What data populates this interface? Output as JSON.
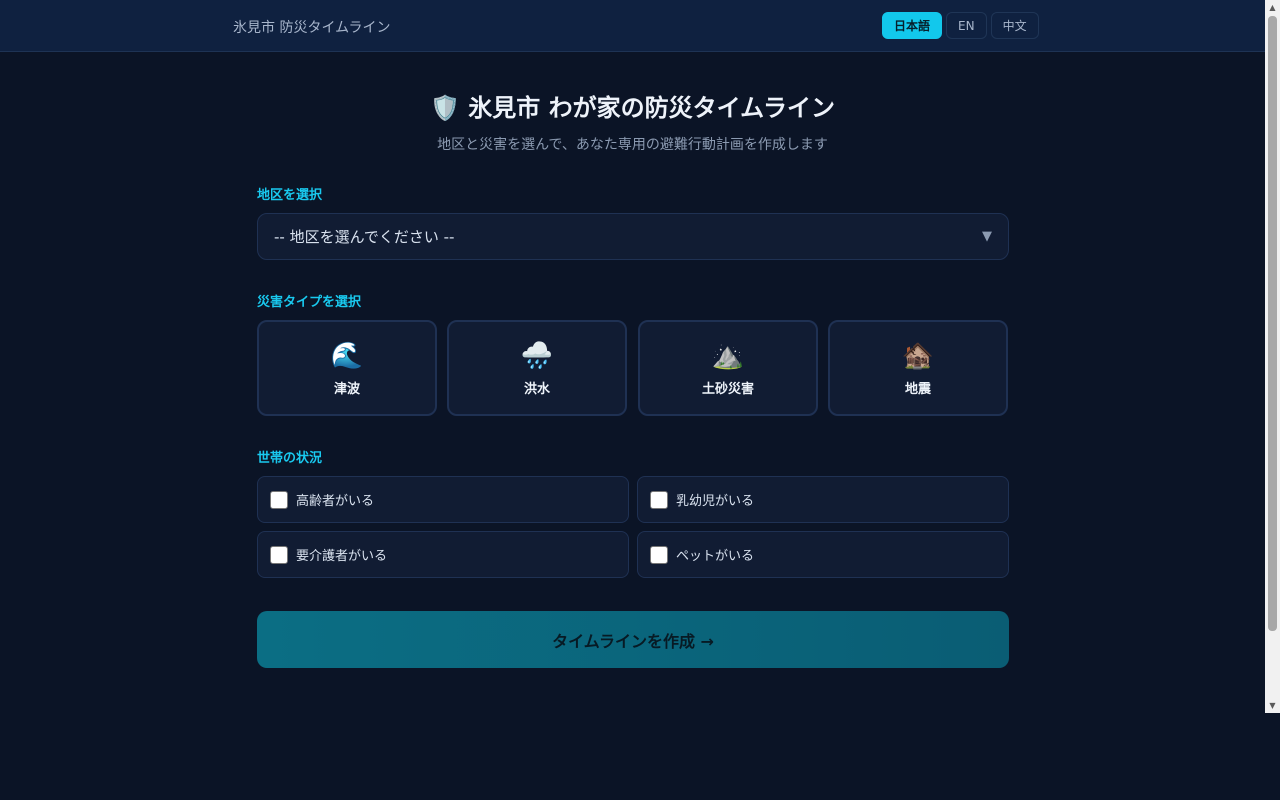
{
  "header": {
    "brand": "氷見市 防災タイムライン",
    "languages": [
      {
        "label": "日本語",
        "active": true
      },
      {
        "label": "EN",
        "active": false
      },
      {
        "label": "中文",
        "active": false
      }
    ]
  },
  "main": {
    "title_icon": "🛡️",
    "title": "氷見市 わが家の防災タイムライン",
    "subtitle": "地区と災害を選んで、あなた専用の避難行動計画を作成します",
    "district": {
      "label": "地区を選択",
      "selected": "-- 地区を選んでください --",
      "chevron": "▼"
    },
    "disaster": {
      "label": "災害タイプを選択",
      "types": [
        {
          "icon": "🌊",
          "icon_name": "wave-icon",
          "label": "津波"
        },
        {
          "icon": "🌧️",
          "icon_name": "rain-cloud-icon",
          "label": "洪水"
        },
        {
          "icon": "⛰️",
          "icon_name": "mountain-icon",
          "label": "土砂災害"
        },
        {
          "icon": "🏚️",
          "icon_name": "damaged-house-icon",
          "label": "地震"
        }
      ]
    },
    "household": {
      "label": "世帯の状況",
      "options": [
        {
          "label": "高齢者がいる",
          "checked": false
        },
        {
          "label": "乳幼児がいる",
          "checked": false
        },
        {
          "label": "要介護者がいる",
          "checked": false
        },
        {
          "label": "ペットがいる",
          "checked": false
        }
      ]
    },
    "submit_label": "タイムラインを作成 →"
  },
  "colors": {
    "accent": "#19c9ef",
    "background": "#0b1426",
    "card": "#111c33",
    "button": "#0b6e84"
  }
}
